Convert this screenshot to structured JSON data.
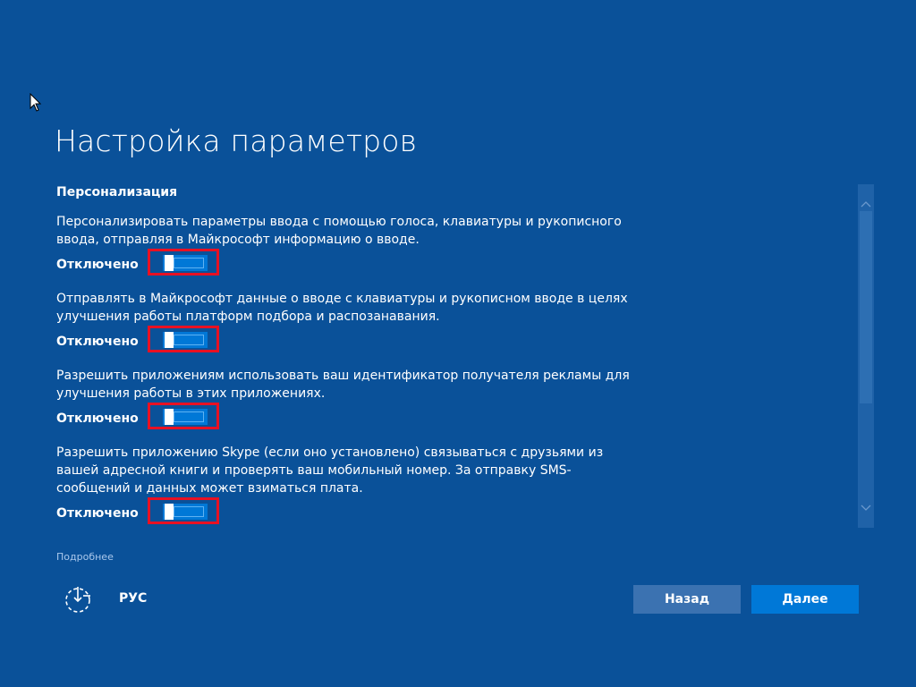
{
  "header": {
    "title": "Настройка параметров"
  },
  "section": {
    "heading": "Персонализация"
  },
  "settings": [
    {
      "description": "Персонализировать параметры ввода с помощью голоса, клавиатуры и рукописного ввода, отправляя в Майкрософт информацию о вводе.",
      "state": "Отключено"
    },
    {
      "description": "Отправлять в Майкрософт данные о вводе с клавиатуры и рукописном вводе в целях улучшения работы платформ подбора и распозанавания.",
      "state": "Отключено"
    },
    {
      "description": "Разрешить приложениям использовать ваш идентификатор получателя рекламы для улучшения работы в этих приложениях.",
      "state": "Отключено"
    },
    {
      "description": "Разрешить приложению Skype (если оно установлено) связываться с друзьями из вашей адресной книги и проверять ваш мобильный номер. За отправку SMS-сообщений и данных может взиматься плата.",
      "state": "Отключено"
    }
  ],
  "footer": {
    "more_link": "Подробнее",
    "language": "РУС",
    "back_label": "Назад",
    "next_label": "Далее"
  },
  "icons": {
    "ease_of_access": "ease-of-access-icon",
    "cursor": "mouse-pointer-icon",
    "scroll_up": "chevron-up-icon",
    "scroll_down": "chevron-down-icon"
  },
  "colors": {
    "background": "#0a5199",
    "accent": "#0078d7",
    "highlight": "#e81123",
    "back_button": "#3b72b1"
  }
}
